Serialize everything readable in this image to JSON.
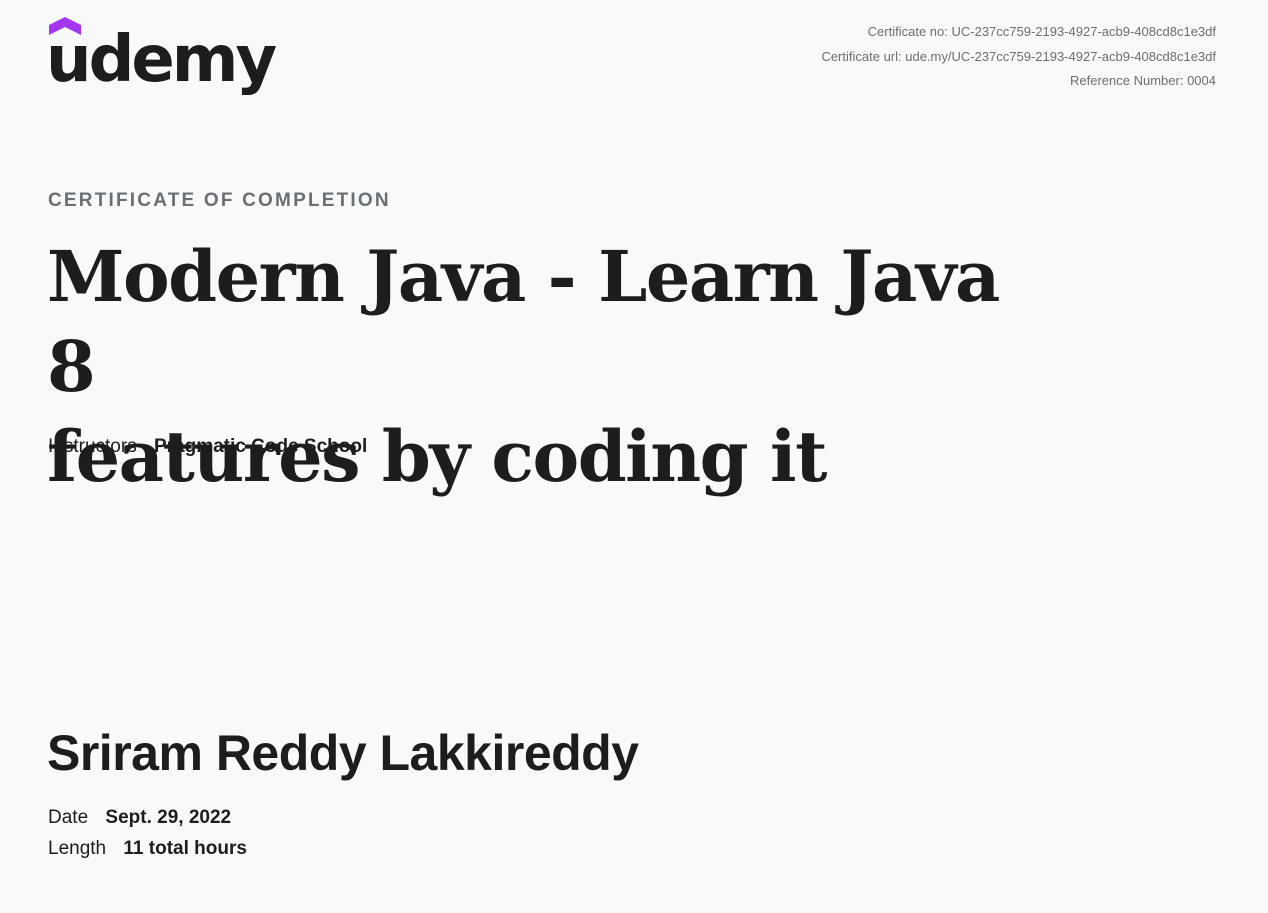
{
  "logo": {
    "text": "udemy",
    "icon": "udemy-hat-icon",
    "accent_color": "#a435f0"
  },
  "certificate": {
    "number_line": "Certificate no: UC-237cc759-2193-4927-acb9-408cd8c1e3df",
    "url_line": "Certificate url: ude.my/UC-237cc759-2193-4927-acb9-408cd8c1e3df",
    "reference_line": "Reference Number: 0004"
  },
  "heading": {
    "eyebrow": "CERTIFICATE OF COMPLETION",
    "title_line1": "Modern Java - Learn Java 8",
    "title_line2": "features by coding it"
  },
  "instructors": {
    "label": "Instructors",
    "value": "Pragmatic Code School"
  },
  "recipient": {
    "name": "Sriram Reddy Lakkireddy"
  },
  "details": {
    "date_label": "Date",
    "date_value": "Sept. 29, 2022",
    "length_label": "Length",
    "length_value": "11 total hours"
  }
}
